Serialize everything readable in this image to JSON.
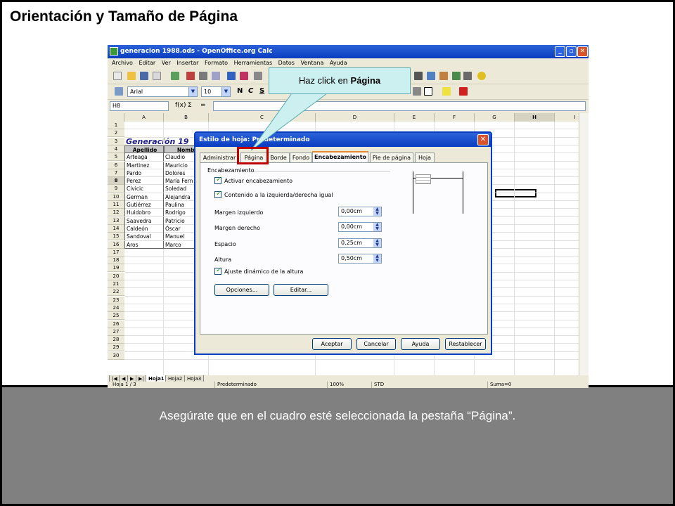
{
  "slide": {
    "title": "Orientación y Tamaño de Página",
    "caption": "Asegúrate que en el cuadro esté seleccionada la pestaña “Página”.",
    "callout_prefix": "Haz click en ",
    "callout_target": "Página"
  },
  "calc": {
    "title": "generacion 1988.ods - OpenOffice.org Calc",
    "menu": [
      "Archivo",
      "Editar",
      "Ver",
      "Insertar",
      "Formato",
      "Herramientas",
      "Datos",
      "Ventana",
      "Ayuda"
    ],
    "font_name": "Arial",
    "font_size": "10",
    "format_buttons": [
      "N",
      "C",
      "S"
    ],
    "name_box": "H8",
    "sum_symbol": "Σ",
    "equals_symbol": "=",
    "fx_symbol": "f(x)",
    "columns": [
      "A",
      "B",
      "C",
      "D",
      "E",
      "F",
      "G",
      "H",
      "I"
    ],
    "selected_column": "H",
    "rows": [
      "1",
      "2",
      "3",
      "4",
      "5",
      "6",
      "7",
      "8",
      "9",
      "10",
      "11",
      "12",
      "13",
      "14",
      "15",
      "16",
      "17",
      "18",
      "19",
      "20",
      "21",
      "22",
      "23",
      "24",
      "25",
      "26",
      "27",
      "28",
      "29",
      "30"
    ],
    "selected_row": "8",
    "sheet_heading": "Generación 19",
    "table_headers": [
      "Apellido",
      "Nombr"
    ],
    "last_names": [
      "Arteaga",
      "Martinez",
      "Pardo",
      "Perez",
      "Civicic",
      "German",
      "Gutiérrez",
      "Huidobro",
      "Saavedra",
      "Caldeón",
      "Sandoval",
      "Aros"
    ],
    "first_names": [
      "Claudio",
      "Mauricio",
      "Dolores",
      "María Fern",
      "Soledad",
      "Alejandra",
      "Paulina",
      "Rodrigo",
      "Patricio",
      "Óscar",
      "Manuel",
      "Marco"
    ],
    "sheet_tabs": [
      "Hoja1",
      "Hoja2",
      "Hoja3"
    ],
    "active_sheet": "Hoja1",
    "status": {
      "sheet": "Hoja 1 / 3",
      "style": "Predeterminado",
      "zoom": "100%",
      "mode": "STD",
      "sum": "Suma=0"
    }
  },
  "dialog": {
    "title": "Estilo de hoja: Predeterminado",
    "tabs": [
      "Administrar",
      "Página",
      "Borde",
      "Fondo",
      "Encabezamiento",
      "Pie de página",
      "Hoja"
    ],
    "active_tab": "Encabezamiento",
    "group_label": "Encabezamiento",
    "activate_header_label": "Activar encabezamiento",
    "same_content_label": "Contenido a la izquierda/derecha igual",
    "fields": [
      {
        "label": "Margen izquierdo",
        "value": "0,00cm"
      },
      {
        "label": "Margen derecho",
        "value": "0,00cm"
      },
      {
        "label": "Espacio",
        "value": "0,25cm"
      },
      {
        "label": "Altura",
        "value": "0,50cm"
      }
    ],
    "autofit_label": "Ajuste dinámico de la altura",
    "options_button": "Opciones...",
    "edit_button": "Editar...",
    "ok_button": "Aceptar",
    "cancel_button": "Cancelar",
    "help_button": "Ayuda",
    "reset_button": "Restablecer",
    "close_glyph": "✕"
  },
  "colors": {
    "highlight": "#c00000",
    "callout_fill": "#ccf0f0",
    "titlebar": "#0a3dc0",
    "caption_panel": "#808080"
  }
}
